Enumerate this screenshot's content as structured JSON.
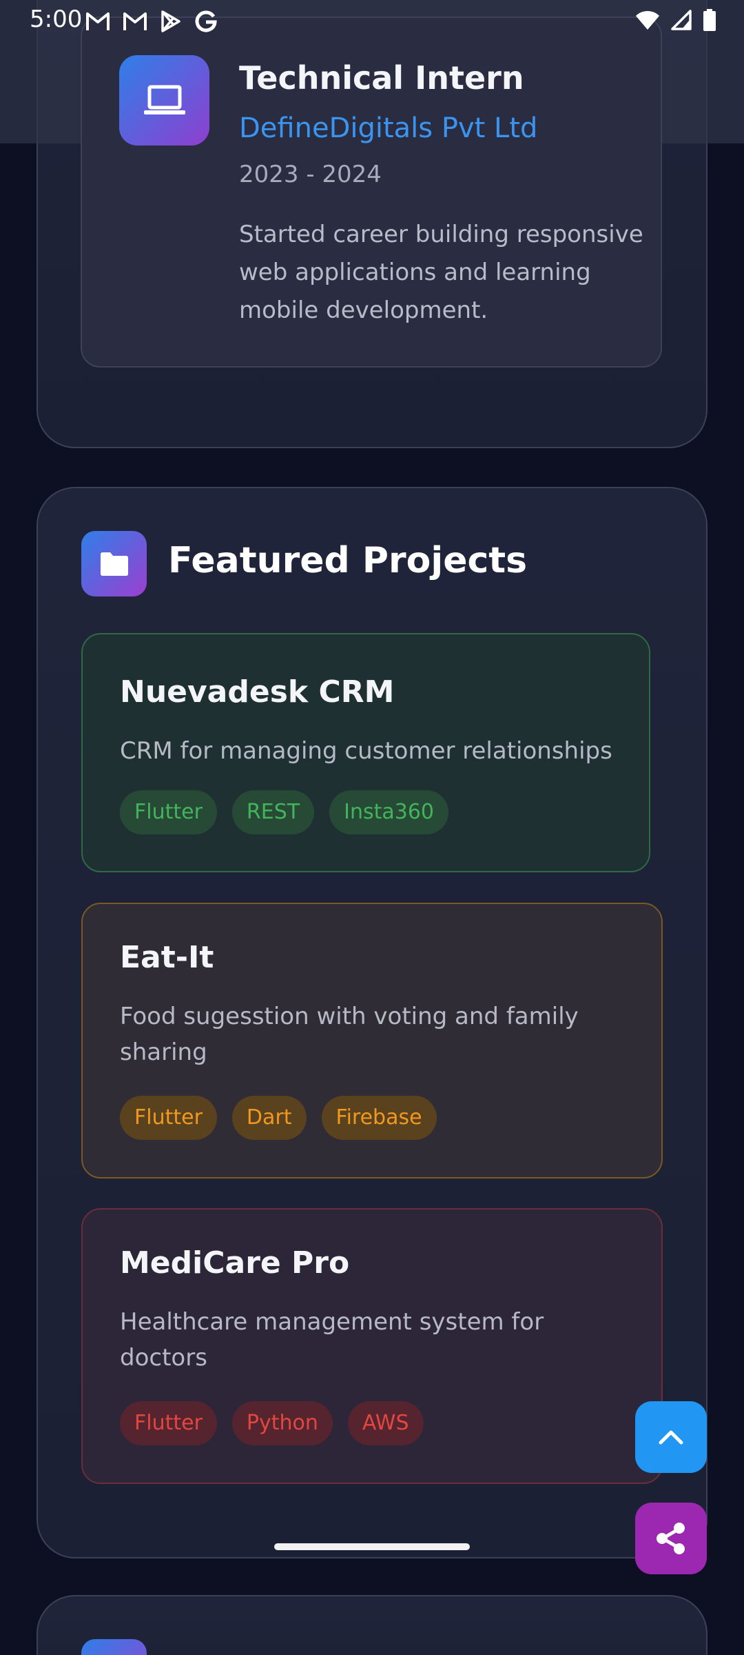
{
  "status_bar": {
    "time": "5:00",
    "left_icons": [
      "gmail-icon",
      "gmail-icon",
      "play-store-icon",
      "google-icon"
    ],
    "right_icons": [
      "wifi-icon",
      "signal-icon",
      "battery-icon"
    ]
  },
  "experience": {
    "icon": "laptop-icon",
    "title": "Technical Intern",
    "company": "DefineDigitals Pvt Ltd",
    "years": "2023 - 2024",
    "description": "Started career building responsive web applications and learning mobile development."
  },
  "projects_section": {
    "icon": "folder-icon",
    "heading": "Featured Projects",
    "projects": [
      {
        "title": "Nuevadesk CRM",
        "description": "CRM for managing customer relationships",
        "tags": [
          "Flutter",
          "REST",
          "Insta360"
        ],
        "accent": "#43b45c"
      },
      {
        "title": "Eat-It",
        "description": "Food sugesstion with voting and family sharing",
        "tags": [
          "Flutter",
          "Dart",
          "Firebase"
        ],
        "accent": "#f0981f"
      },
      {
        "title": "MediCare Pro",
        "description": "Healthcare management system for doctors",
        "tags": [
          "Flutter",
          "Python",
          "AWS"
        ],
        "accent": "#e2473f"
      }
    ]
  },
  "fabs": {
    "scroll_top_icon": "chevron-up-icon",
    "scroll_top_color": "#2196f3",
    "share_icon": "share-icon",
    "share_color": "#9c27b0"
  }
}
